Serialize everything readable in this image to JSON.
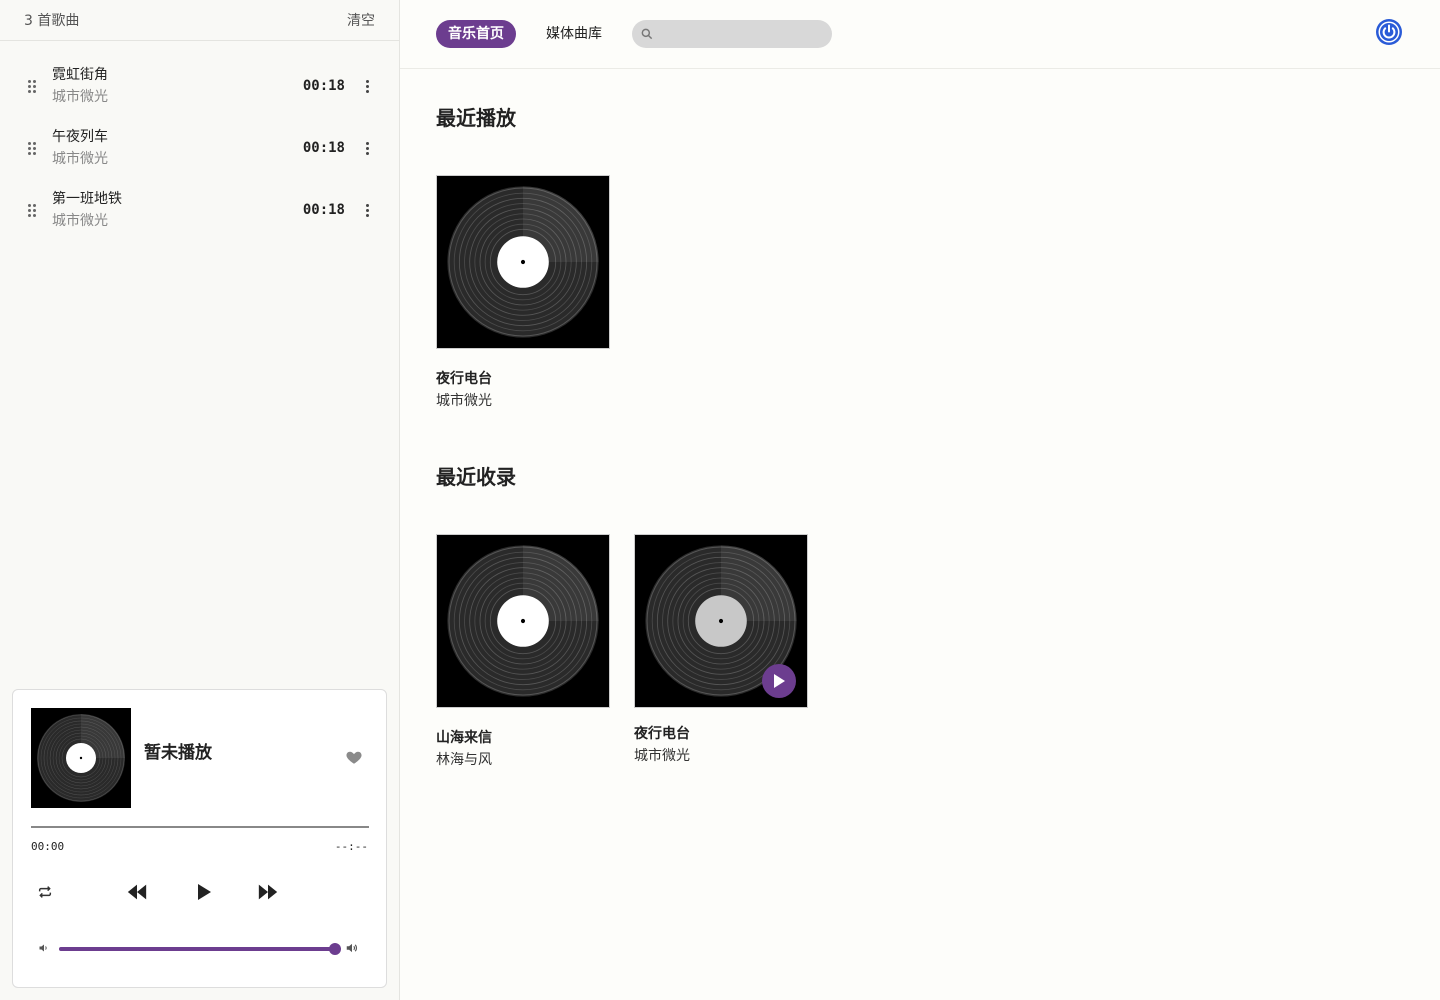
{
  "queue": {
    "count_label": "3 首歌曲",
    "clear_label": "清空",
    "tracks": [
      {
        "title": "霓虹街角",
        "artist": "城市微光",
        "duration": "00:18"
      },
      {
        "title": "午夜列车",
        "artist": "城市微光",
        "duration": "00:18"
      },
      {
        "title": "第一班地铁",
        "artist": "城市微光",
        "duration": "00:18"
      }
    ]
  },
  "player": {
    "title": "暂未播放",
    "time_current": "00:00",
    "time_total": "--:--",
    "progress": 0,
    "volume": 1.0
  },
  "nav": {
    "home_label": "音乐首页",
    "library_label": "媒体曲库",
    "search_placeholder": ""
  },
  "sections": {
    "recent_played": {
      "title": "最近播放",
      "albums": [
        {
          "title": "夜行电台",
          "artist": "城市微光"
        }
      ]
    },
    "recent_added": {
      "title": "最近收录",
      "albums": [
        {
          "title": "山海来信",
          "artist": "林海与风"
        },
        {
          "title": "夜行电台",
          "artist": "城市微光"
        }
      ]
    }
  },
  "icons": {
    "drag": "drag-handle-icon",
    "more": "more-vertical-icon",
    "heart": "heart-icon",
    "repeat": "repeat-icon",
    "rewind": "rewind-icon",
    "play": "play-icon",
    "forward": "fast-forward-icon",
    "volume_low": "volume-low-icon",
    "volume_high": "volume-high-icon",
    "search": "search-icon",
    "power": "power-icon"
  },
  "colors": {
    "accent": "#6c3d8f",
    "power": "#2a5bd7",
    "background": "#fdfdfa",
    "sidebar": "#f9f9f6"
  }
}
